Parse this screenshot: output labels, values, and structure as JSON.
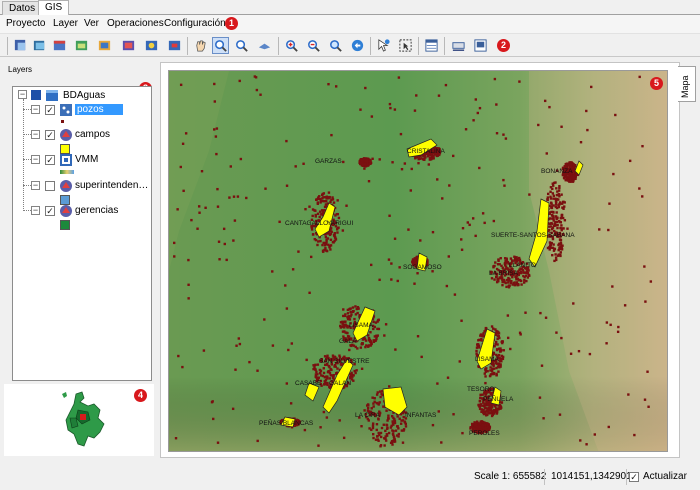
{
  "top_tabs": [
    "Datos",
    "GIS"
  ],
  "menu": {
    "items": [
      "Proyecto",
      "Layer",
      "Ver",
      "Operaciones",
      "Configuración"
    ]
  },
  "badges": [
    "1",
    "2",
    "3",
    "4",
    "5"
  ],
  "toolbar": {
    "buttons": [
      "project-icon",
      "open-project-icon",
      "add-layer-icon",
      "add-raster-icon",
      "add-vector-icon",
      "database-icon",
      "layer-properties-icon",
      "remove-layer-icon",
      "pan-hand-icon",
      "zoom-box-icon",
      "zoom-in-icon",
      "zoom-out-icon",
      "zoom-full-icon",
      "zoom-layer-icon",
      "zoom-selection-icon",
      "refresh-icon",
      "identify-icon",
      "select-icon",
      "attribute-table-icon",
      "measure-icon",
      "print-icon"
    ]
  },
  "layers_panel": {
    "title": "Layers",
    "group": "BDAguas",
    "layers": [
      {
        "name": "pozos",
        "checked": true,
        "selected": true,
        "legend": "point"
      },
      {
        "name": "campos",
        "checked": true,
        "selected": false,
        "legend": "#ffff00"
      },
      {
        "name": "VMM",
        "checked": true,
        "selected": false,
        "legend": "gradient"
      },
      {
        "name": "superintenden…",
        "checked": false,
        "selected": false,
        "legend": "#5b9bd5"
      },
      {
        "name": "gerencias",
        "checked": true,
        "selected": false,
        "legend": "#1c8a3c"
      }
    ]
  },
  "map": {
    "side_tab": "Mapa",
    "labels": [
      "GARZAS",
      "CRISTALINA",
      "BONANZA",
      "LISAMA",
      "CANTAGALLO",
      "YARIGUI",
      "SUERTE-SANTOS-SABANA",
      "SOGAMOSO",
      "LA BRISA",
      "LLANITO",
      "GALA",
      "SAN SILVESTRE",
      "CASABE",
      "GALAN",
      "LA CIRA",
      "INFANTAS",
      "PEÑAS BLANCAS",
      "LISAMA",
      "TESORO",
      "PEÑUELA",
      "PEROLES"
    ]
  },
  "status": {
    "scale": "Scale 1: 655582",
    "coords": "1014151,1342901",
    "refresh_label": "Actualizar"
  },
  "colors": {
    "accent_badge": "#d8181c",
    "selection": "#3399ff",
    "campos_fill": "#ffff00",
    "pozos_point": "#7a1010"
  }
}
